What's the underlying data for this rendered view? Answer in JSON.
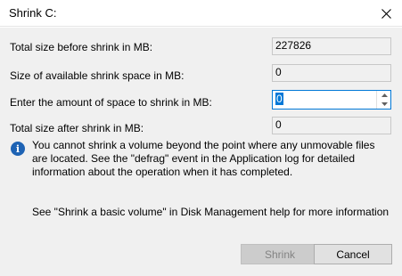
{
  "window": {
    "title": "Shrink C:",
    "close_icon": "close-icon"
  },
  "rows": [
    {
      "label": "Total size before shrink in MB:",
      "value": "227826"
    },
    {
      "label": "Size of available shrink space in MB:",
      "value": "0"
    },
    {
      "label": "Enter the amount of space to shrink in MB:",
      "value": "0"
    },
    {
      "label": "Total size after shrink in MB:",
      "value": "0"
    }
  ],
  "info": {
    "icon": "info-icon",
    "text": "You cannot shrink a volume beyond the point where any unmovable files are located. See the \"defrag\" event in the Application log for detailed information about the operation when it has completed."
  },
  "help_text": "See \"Shrink a basic volume\" in Disk Management help for more information",
  "buttons": {
    "shrink": "Shrink",
    "cancel": "Cancel"
  },
  "colors": {
    "accent": "#0078d7",
    "info_icon": "#1e63b4"
  }
}
